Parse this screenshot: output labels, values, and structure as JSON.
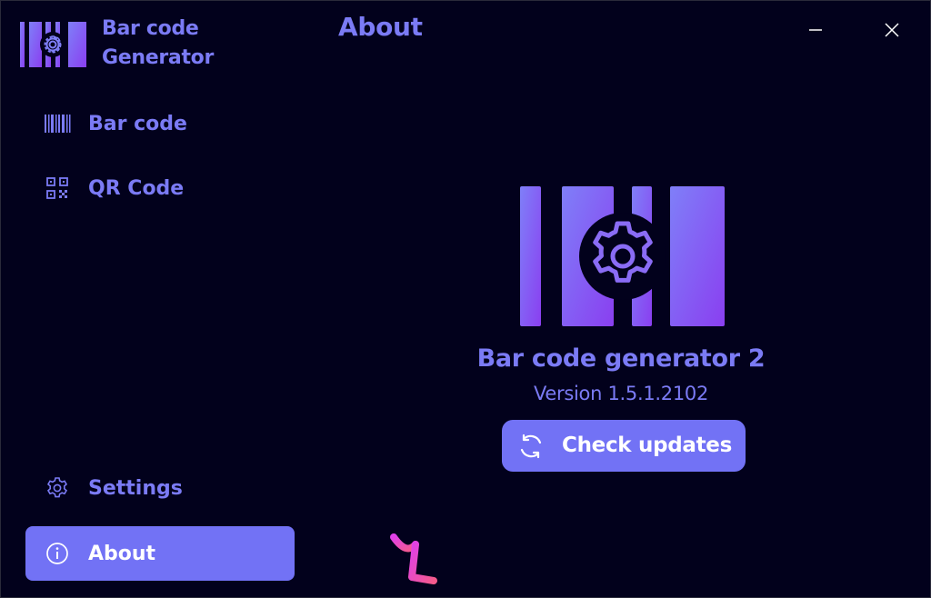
{
  "app": {
    "title_line1": "Bar code",
    "title_line2": "Generator",
    "logo_icon": "barcode-gear-logo"
  },
  "page": {
    "title": "About"
  },
  "window_controls": {
    "minimize_icon": "minimize-icon",
    "close_icon": "close-icon"
  },
  "nav": {
    "items": [
      {
        "label": "Bar code",
        "icon": "barcode-icon",
        "selected": false
      },
      {
        "label": "QR Code",
        "icon": "qr-code-icon",
        "selected": false
      }
    ],
    "footer_items": [
      {
        "label": "Settings",
        "icon": "gear-icon",
        "selected": false
      },
      {
        "label": "About",
        "icon": "info-icon",
        "selected": true
      }
    ]
  },
  "about": {
    "product_name": "Bar code generator 2",
    "version": "Version 1.5.1.2102",
    "check_updates_label": "Check updates",
    "check_updates_icon": "refresh-icon",
    "brand_mark": "developer-logo"
  },
  "colors": {
    "background": "#02011c",
    "accent": "#7272f5",
    "text": "#7b7bf5",
    "logo_gradient_start": "#7f7ff8",
    "logo_gradient_end": "#8a3ff0"
  }
}
